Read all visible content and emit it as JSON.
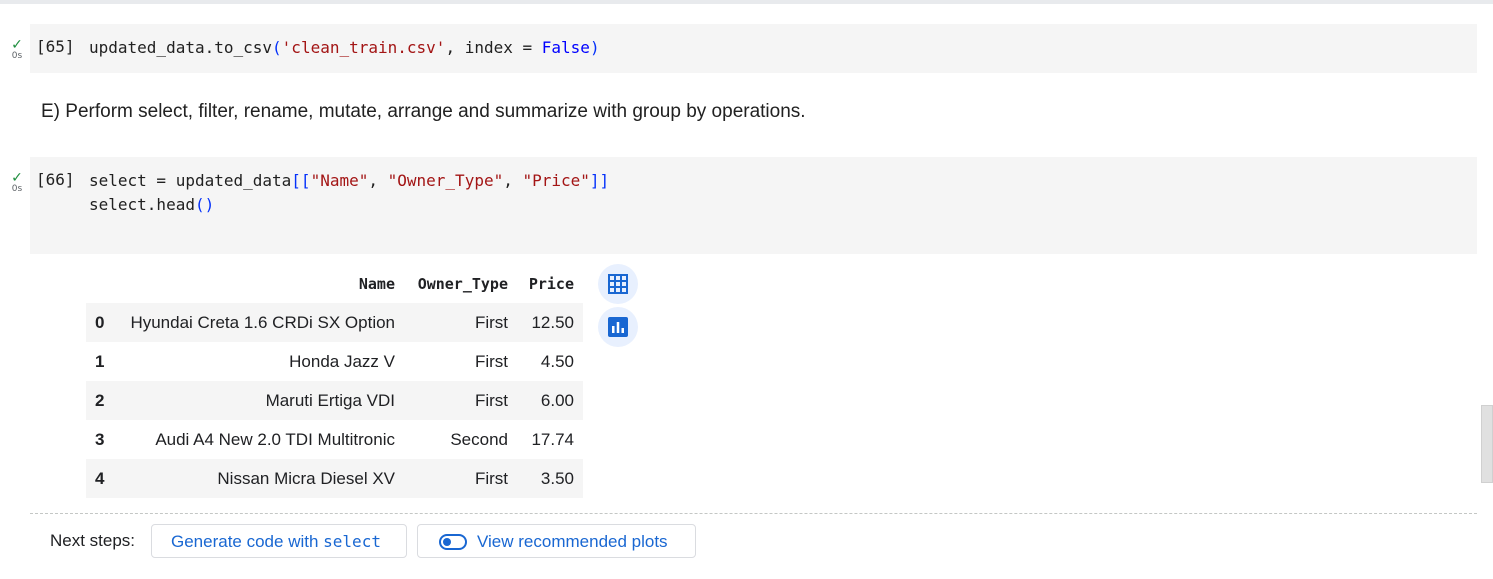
{
  "cells": [
    {
      "exec_count": "[65]",
      "time": "0s",
      "code_line1": {
        "plain1": "updated_data.to_csv",
        "br1": "(",
        "str1": "'clean_train.csv'",
        "plain2": ", index = ",
        "kw1": "False",
        "br2": ")"
      }
    },
    {
      "exec_count": "[66]",
      "time": "0s",
      "code_line1": {
        "plain1": "select = updated_data",
        "br1": "[[",
        "str1": "\"Name\"",
        "c1": ", ",
        "str2": "\"Owner_Type\"",
        "c2": ", ",
        "str3": "\"Price\"",
        "br2": "]]"
      },
      "code_line2": {
        "plain1": "select.head",
        "br1": "()"
      }
    }
  ],
  "markdown_text": "E) Perform select, filter, rename, mutate, arrange and summarize with group by operations.",
  "dataframe": {
    "columns": [
      "Name",
      "Owner_Type",
      "Price"
    ],
    "rows": [
      {
        "index": "0",
        "Name": "Hyundai Creta 1.6 CRDi SX Option",
        "Owner_Type": "First",
        "Price": "12.50"
      },
      {
        "index": "1",
        "Name": "Honda Jazz V",
        "Owner_Type": "First",
        "Price": "4.50"
      },
      {
        "index": "2",
        "Name": "Maruti Ertiga VDI",
        "Owner_Type": "First",
        "Price": "6.00"
      },
      {
        "index": "3",
        "Name": "Audi A4 New 2.0 TDI Multitronic",
        "Owner_Type": "Second",
        "Price": "17.74"
      },
      {
        "index": "4",
        "Name": "Nissan Micra Diesel XV",
        "Owner_Type": "First",
        "Price": "3.50"
      }
    ]
  },
  "side_buttons": {
    "table_icon": "table-icon",
    "chart_icon": "bar-chart-icon"
  },
  "next_steps": {
    "label": "Next steps:",
    "generate_prefix": "Generate code with ",
    "generate_var": "select",
    "plots_label": "View recommended plots",
    "plots_icon": "toggle-icon"
  },
  "colors": {
    "check": "#1e8e3e",
    "link": "#1967d2",
    "cell_bg": "#f5f5f5"
  }
}
